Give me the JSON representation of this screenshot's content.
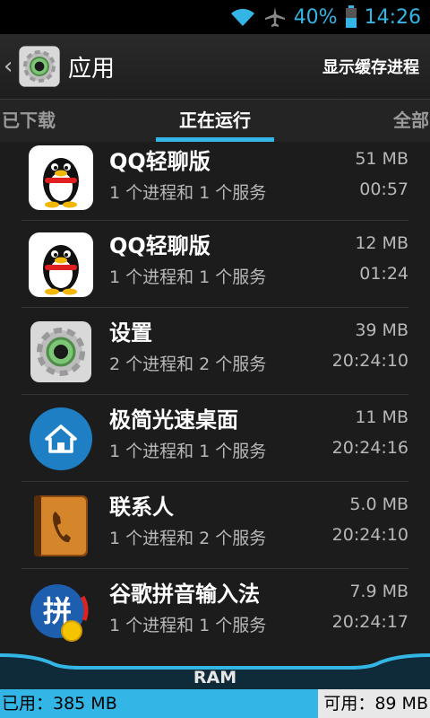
{
  "status_bar": {
    "battery": "40%",
    "time": "14:26"
  },
  "action_bar": {
    "title": "应用",
    "action": "显示缓存进程"
  },
  "tabs": [
    {
      "label": "已下载"
    },
    {
      "label": "正在运行"
    },
    {
      "label": "全部"
    }
  ],
  "active_tab": 1,
  "apps": [
    {
      "name": "QQ轻聊版",
      "desc": "1 个进程和 1 个服务",
      "size": "51 MB",
      "time": "00:57",
      "icon": "qq-penguin-icon"
    },
    {
      "name": "QQ轻聊版",
      "desc": "1 个进程和 1 个服务",
      "size": "12 MB",
      "time": "01:24",
      "icon": "qq-penguin-icon"
    },
    {
      "name": "设置",
      "desc": "2 个进程和 2 个服务",
      "size": "39 MB",
      "time": "20:24:10",
      "icon": "settings-gear-icon"
    },
    {
      "name": "极简光速桌面",
      "desc": "1 个进程和 1 个服务",
      "size": "11 MB",
      "time": "20:24:16",
      "icon": "home-launcher-icon"
    },
    {
      "name": "联系人",
      "desc": "1 个进程和 2 个服务",
      "size": "5.0 MB",
      "time": "20:24:10",
      "icon": "contacts-book-icon"
    },
    {
      "name": "谷歌拼音输入法",
      "desc": "1 个进程和 1 个服务",
      "size": "7.9 MB",
      "time": "20:24:17",
      "icon": "pinyin-ime-icon"
    }
  ],
  "ram": {
    "label": "RAM",
    "used": "已用：385 MB",
    "free": "可用：89 MB",
    "used_fraction": 0.812
  },
  "colors": {
    "accent": "#33b5e5",
    "background": "#1c1c1c"
  }
}
